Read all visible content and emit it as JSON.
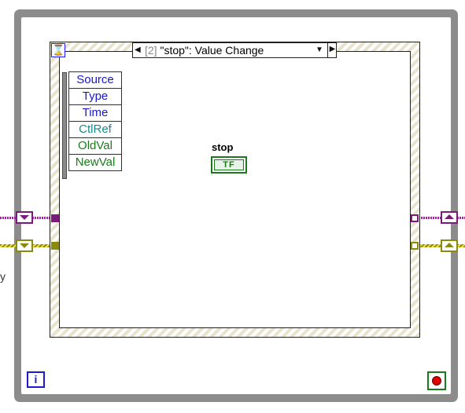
{
  "event_structure": {
    "case_index": "[2]",
    "case_label": "\"stop\": Value Change",
    "event_data_node": [
      {
        "label": "Source",
        "color": "#1818d0"
      },
      {
        "label": "Type",
        "color": "#1818d0"
      },
      {
        "label": "Time",
        "color": "#1818d0"
      },
      {
        "label": "CtlRef",
        "color": "#1a8a8a"
      },
      {
        "label": "OldVal",
        "color": "#1a7a1a"
      },
      {
        "label": "NewVal",
        "color": "#1a7a1a"
      }
    ]
  },
  "stop_control": {
    "label": "stop",
    "terminal_text": "TF"
  },
  "while_loop": {
    "iteration_label": "i"
  },
  "edge_label": "y",
  "icons": {
    "timeout": "hourglass-icon",
    "loop_condition": "stop-condition-icon",
    "shift_register_left": "shift-register-down-icon",
    "shift_register_right": "shift-register-up-icon"
  },
  "colors": {
    "loop_frame": "#8c8c8c",
    "cluster_wire": "#9a2a9a",
    "refnum_wire": "#8a8a10",
    "boolean": "#1a7a1a"
  }
}
